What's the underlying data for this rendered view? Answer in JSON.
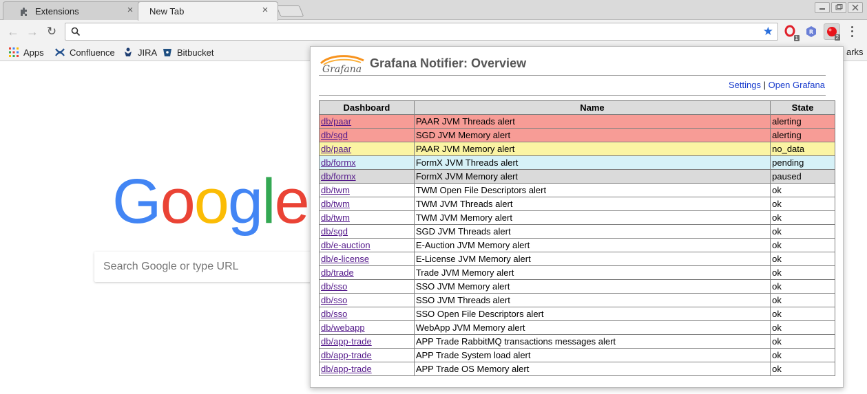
{
  "tabs": [
    {
      "title": "Extensions",
      "close": "×"
    },
    {
      "title": "New Tab",
      "close": "×"
    }
  ],
  "toolbar": {
    "back": "←",
    "forward": "→",
    "reload": "↻",
    "omnibox_value": "",
    "extensions": [
      {
        "name": "opera-icon",
        "badge": "1"
      },
      {
        "name": "r-extension-icon",
        "badge": ""
      },
      {
        "name": "grafana-notifier-icon",
        "badge": "2"
      }
    ]
  },
  "bookmarks": {
    "items": [
      "Apps",
      "Confluence",
      "JIRA",
      "Bitbucket"
    ],
    "overflow_label": "arks"
  },
  "ntp": {
    "logo": "Google",
    "logo_colors": [
      "#4285F4",
      "#EA4335",
      "#FBBC05",
      "#4285F4",
      "#34A853",
      "#EA4335"
    ],
    "search_placeholder": "Search Google or type URL"
  },
  "popup": {
    "title": "Grafana Notifier: Overview",
    "logo_text": "Grafana",
    "links": {
      "settings": "Settings",
      "separator": "|",
      "open": "Open Grafana"
    },
    "columns": [
      "Dashboard",
      "Name",
      "State"
    ],
    "rows": [
      {
        "dashboard": "db/paar",
        "name": "PAAR JVM Threads alert",
        "state": "alerting"
      },
      {
        "dashboard": "db/sgd",
        "name": "SGD JVM Memory alert",
        "state": "alerting"
      },
      {
        "dashboard": "db/paar",
        "name": "PAAR JVM Memory alert",
        "state": "no_data"
      },
      {
        "dashboard": "db/formx",
        "name": "FormX JVM Threads alert",
        "state": "pending"
      },
      {
        "dashboard": "db/formx",
        "name": "FormX JVM Memory alert",
        "state": "paused"
      },
      {
        "dashboard": "db/twm",
        "name": "TWM Open File Descriptors alert",
        "state": "ok"
      },
      {
        "dashboard": "db/twm",
        "name": "TWM JVM Threads alert",
        "state": "ok"
      },
      {
        "dashboard": "db/twm",
        "name": "TWM JVM Memory alert",
        "state": "ok"
      },
      {
        "dashboard": "db/sgd",
        "name": "SGD JVM Threads alert",
        "state": "ok"
      },
      {
        "dashboard": "db/e-auction",
        "name": "E-Auction JVM Memory alert",
        "state": "ok"
      },
      {
        "dashboard": "db/e-license",
        "name": "E-License JVM Memory alert",
        "state": "ok"
      },
      {
        "dashboard": "db/trade",
        "name": "Trade JVM Memory alert",
        "state": "ok"
      },
      {
        "dashboard": "db/sso",
        "name": "SSO JVM Memory alert",
        "state": "ok"
      },
      {
        "dashboard": "db/sso",
        "name": "SSO JVM Threads alert",
        "state": "ok"
      },
      {
        "dashboard": "db/sso",
        "name": "SSO Open File Descriptors alert",
        "state": "ok"
      },
      {
        "dashboard": "db/webapp",
        "name": "WebApp JVM Memory alert",
        "state": "ok"
      },
      {
        "dashboard": "db/app-trade",
        "name": "APP Trade RabbitMQ transactions messages alert",
        "state": "ok"
      },
      {
        "dashboard": "db/app-trade",
        "name": "APP Trade System load alert",
        "state": "ok"
      },
      {
        "dashboard": "db/app-trade",
        "name": "APP Trade OS Memory alert",
        "state": "ok"
      }
    ],
    "state_colors": {
      "alerting": "#f79c96",
      "no_data": "#fbf4a3",
      "pending": "#d6f1f7",
      "paused": "#dadada",
      "ok": "#ffffff"
    }
  }
}
